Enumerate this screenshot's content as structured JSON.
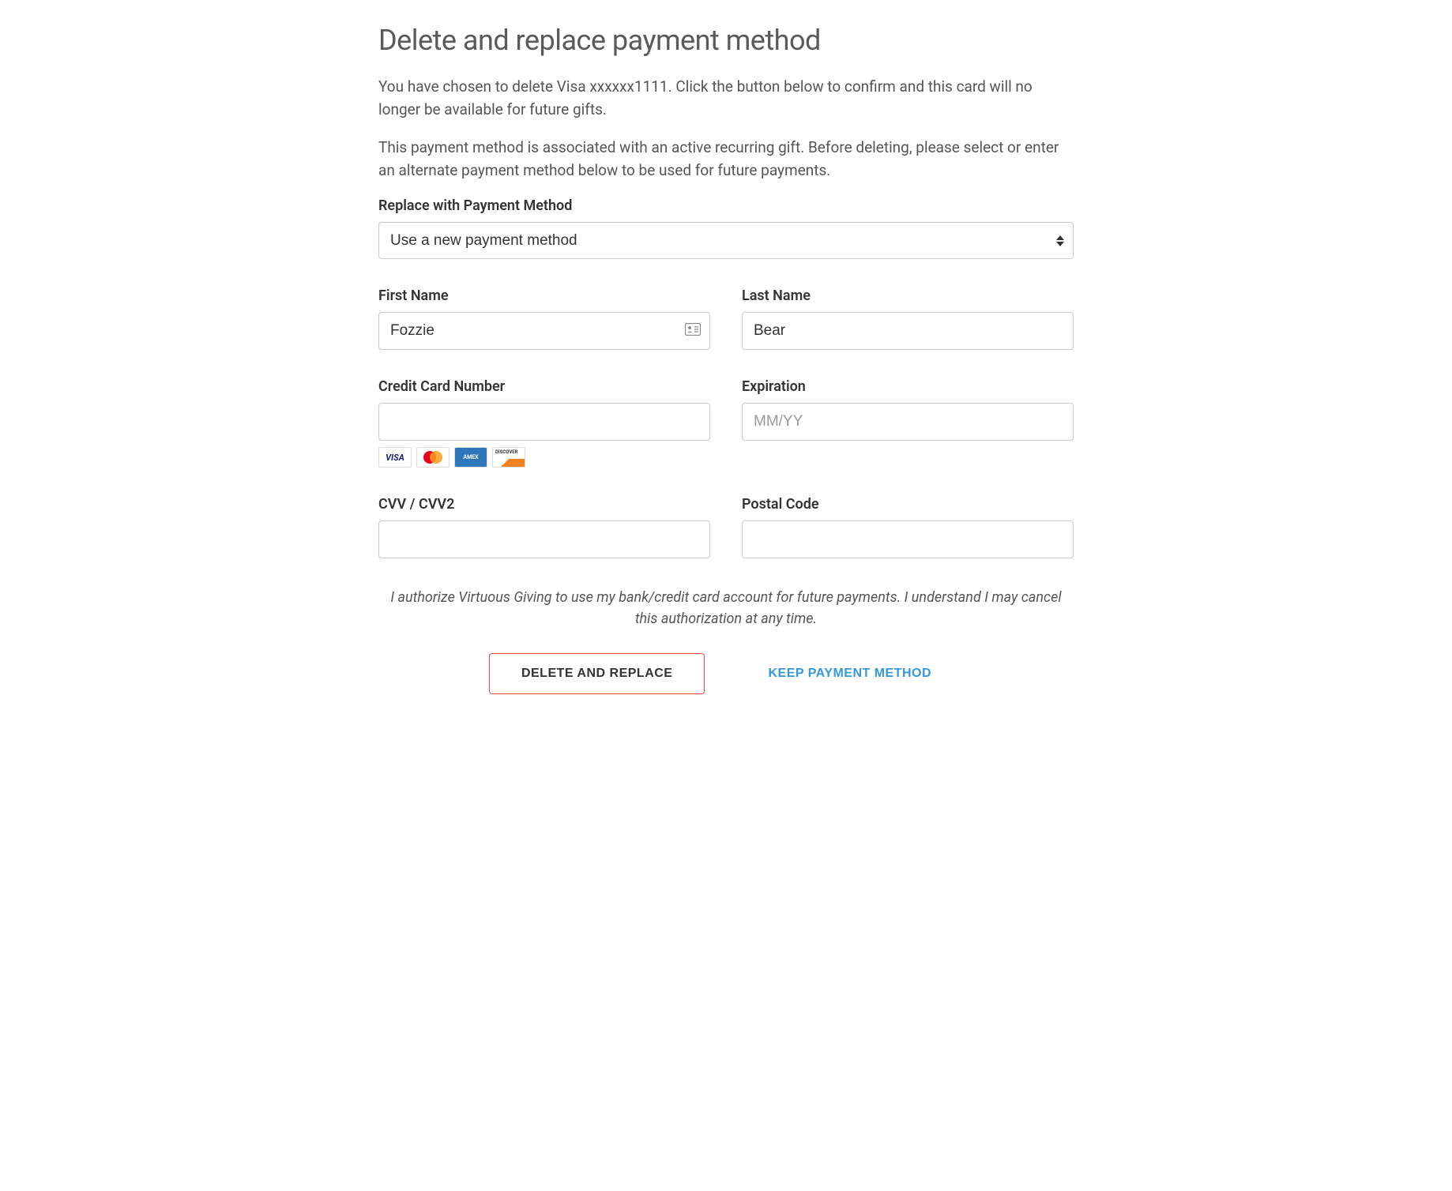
{
  "title": "Delete and replace payment method",
  "paragraph1": "You have chosen to delete Visa xxxxxx1111. Click the button below to confirm and this card will no longer be available for future gifts.",
  "paragraph2": "This payment method is associated with an active recurring gift. Before deleting, please select or enter an alternate payment method below to be used for future payments.",
  "replace_label": "Replace with Payment Method",
  "replace_value": "Use a new payment method",
  "fields": {
    "first_name": {
      "label": "First Name",
      "value": "Fozzie"
    },
    "last_name": {
      "label": "Last Name",
      "value": "Bear"
    },
    "cc_number": {
      "label": "Credit Card Number",
      "value": ""
    },
    "expiration": {
      "label": "Expiration",
      "value": "",
      "placeholder": "MM/YY"
    },
    "cvv": {
      "label": "CVV / CVV2",
      "value": ""
    },
    "postal": {
      "label": "Postal Code",
      "value": ""
    }
  },
  "card_brands": [
    "visa",
    "mastercard",
    "amex",
    "discover"
  ],
  "authorization_text": "I authorize Virtuous Giving to use my bank/credit card account for future payments. I understand I may cancel this authorization at any time.",
  "buttons": {
    "delete_replace": "DELETE AND REPLACE",
    "keep": "KEEP PAYMENT METHOD"
  }
}
